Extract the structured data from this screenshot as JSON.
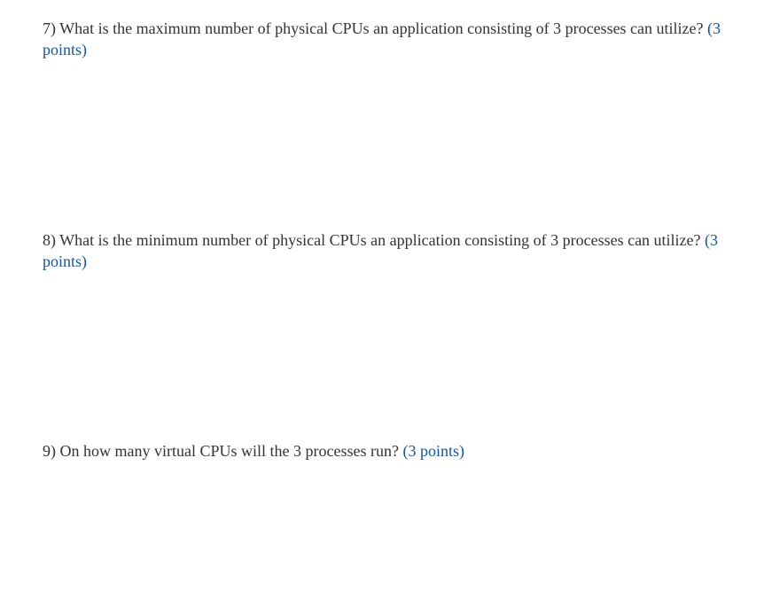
{
  "questions": [
    {
      "number": "7)",
      "text": " What is the maximum number of physical CPUs an application consisting of 3 processes can utilize? ",
      "points": "(3 points)"
    },
    {
      "number": "8)",
      "text": " What is the minimum number of physical CPUs an application consisting of 3 processes can utilize? ",
      "points": "(3 points)"
    },
    {
      "number": "9)",
      "text": " On how many virtual CPUs will the 3 processes run? ",
      "points": "(3 points)"
    }
  ]
}
